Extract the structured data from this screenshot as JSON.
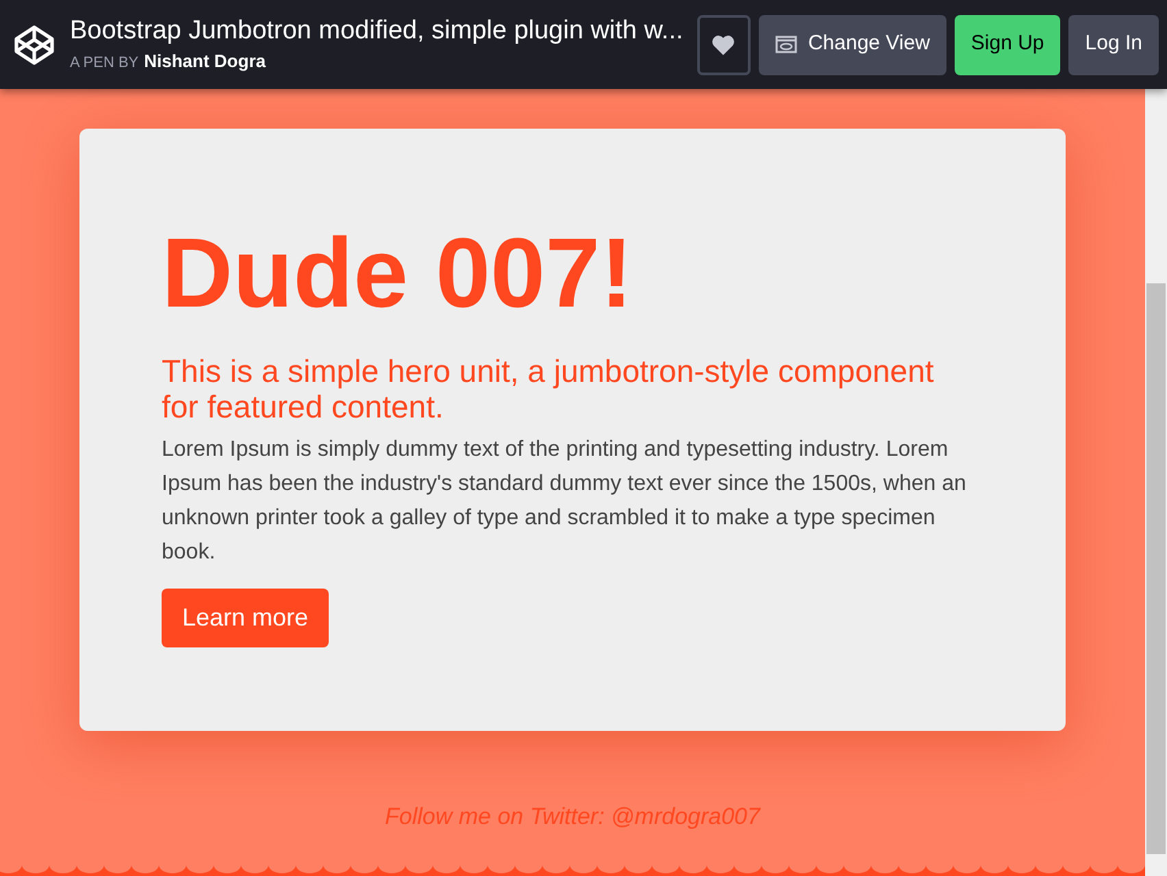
{
  "header": {
    "title": "Bootstrap Jumbotron modified, simple plugin with w...",
    "byline_prefix": "A PEN BY",
    "author": "Nishant Dogra",
    "buttons": [
      {
        "kind": "heart"
      },
      {
        "kind": "view",
        "label": "Change View"
      },
      {
        "kind": "signup",
        "label": "Sign Up"
      },
      {
        "kind": "login",
        "label": "Log In"
      }
    ]
  },
  "hero": {
    "heading": "Dude 007!",
    "lead": "This is a simple hero unit, a jumbotron-style component for featured content.",
    "body": "Lorem Ipsum is simply dummy text of the printing and typesetting industry. Lorem Ipsum has been the industry's standard dummy text ever since the 1500s, when an unknown printer took a galley of type and scrambled it to make a type specimen book.",
    "button": "Learn more"
  },
  "footer": {
    "text": "Follow me on Twitter: @mrdogra007"
  }
}
